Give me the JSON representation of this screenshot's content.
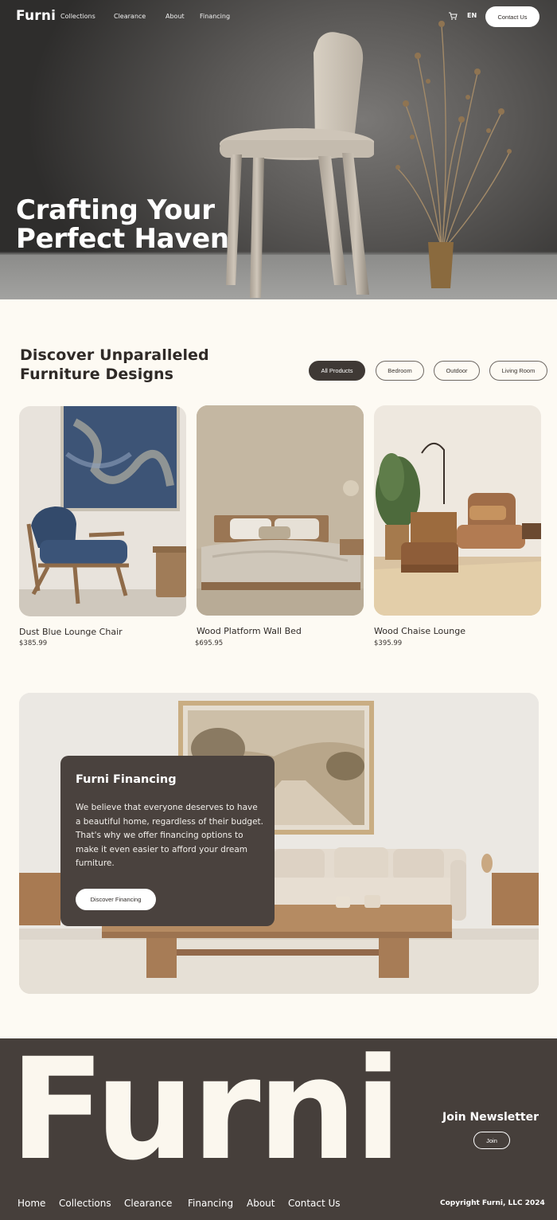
{
  "nav": {
    "brand": "Furni",
    "links": [
      "Collections",
      "Clearance",
      "About",
      "Financing"
    ],
    "cart_icon": "cart-icon",
    "lang": "EN",
    "contact": "Contact Us"
  },
  "hero": {
    "title": "Crafting Your Perfect Haven"
  },
  "products": {
    "title": "Discover Unparalleled Furniture Designs",
    "filters": [
      "All Products",
      "Bedroom",
      "Outdoor",
      "Living Room"
    ],
    "active_filter": "All Products",
    "items": [
      {
        "name": "Dust Blue Lounge Chair",
        "price": "$385.99"
      },
      {
        "name": "Wood Platform Wall Bed",
        "price": "$695.95"
      },
      {
        "name": "Wood Chaise Lounge",
        "price": "$395.99"
      }
    ]
  },
  "financing": {
    "title": "Furni Financing",
    "body": "We believe that everyone deserves to have a beautiful home, regardless of their budget. That's why we offer financing options to make it even easier to afford your dream furniture.",
    "button": "Discover Financing"
  },
  "footer": {
    "brand": "Furni",
    "newsletter_title": "Join Newsletter",
    "join": "Join",
    "links": [
      "Home",
      "Collections",
      "Clearance",
      "Financing",
      "About",
      "Contact Us"
    ],
    "copyright": "Copyright Furni, LLC 2024"
  },
  "colors": {
    "background": "#fdfaf3",
    "dark": "#463f3b",
    "accent": "#3f3935"
  }
}
